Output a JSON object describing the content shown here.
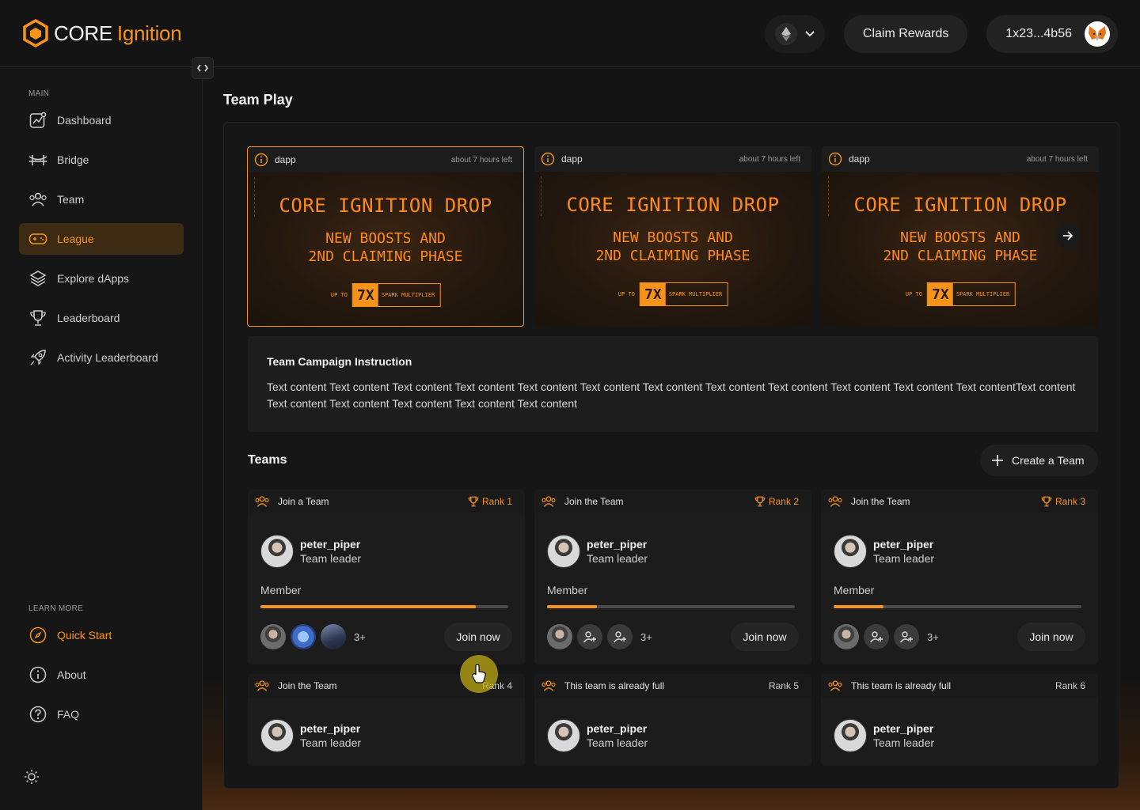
{
  "brand": {
    "core": "CORE",
    "ignition": "Ignition"
  },
  "header": {
    "claim_label": "Claim Rewards",
    "wallet_address": "1x23...4b56",
    "chain_icon": "ethereum-icon"
  },
  "sidebar": {
    "main_label": "MAIN",
    "items": [
      {
        "label": "Dashboard",
        "icon": "chart-icon"
      },
      {
        "label": "Bridge",
        "icon": "bridge-icon"
      },
      {
        "label": "Team",
        "icon": "users-icon"
      },
      {
        "label": "League",
        "icon": "gamepad-icon",
        "active": true
      },
      {
        "label": "Explore dApps",
        "icon": "layers-icon"
      },
      {
        "label": "Leaderboard",
        "icon": "trophy-icon"
      },
      {
        "label": "Activity Leaderboard",
        "icon": "rocket-icon"
      }
    ],
    "learn_label": "LEARN MORE",
    "learn_items": [
      {
        "label": "Quick Start",
        "icon": "compass-icon"
      },
      {
        "label": "About",
        "icon": "info-icon"
      },
      {
        "label": "FAQ",
        "icon": "question-icon"
      }
    ]
  },
  "page": {
    "title": "Team Play"
  },
  "banners": [
    {
      "tag": "dapp",
      "time": "about 7 hours left",
      "headline": "CORE IGNITION DROP",
      "line1": "NEW BOOSTS AND",
      "line2": "2ND CLAIMING PHASE",
      "up_to": "UP TO",
      "multiplier": "7X",
      "mult_label": "SPARK MULTIPLIER",
      "selected": true
    },
    {
      "tag": "dapp",
      "time": "about 7 hours left",
      "headline": "CORE IGNITION DROP",
      "line1": "NEW BOOSTS AND",
      "line2": "2ND CLAIMING PHASE",
      "up_to": "UP TO",
      "multiplier": "7X",
      "mult_label": "SPARK MULTIPLIER"
    },
    {
      "tag": "dapp",
      "time": "about 7 hours left",
      "headline": "CORE IGNITION DROP",
      "line1": "NEW BOOSTS AND",
      "line2": "2ND CLAIMING PHASE",
      "up_to": "UP TO",
      "multiplier": "7X",
      "mult_label": "SPARK MULTIPLIER"
    }
  ],
  "instruction": {
    "title": "Team Campaign Instruction",
    "body": "Text content Text content Text content Text content Text content Text content Text content Text content Text content Text content Text content Text contentText content Text content Text content Text content Text content Text content"
  },
  "teams_section": {
    "title": "Teams",
    "create_label": "Create a Team"
  },
  "teams": [
    {
      "status": "Join a Team",
      "rank": "Rank 1",
      "leader": "peter_piper",
      "role": "Team leader",
      "member_label": "Member",
      "fill": 0.87,
      "more": "3+",
      "join": "Join now"
    },
    {
      "status": "Join the Team",
      "rank": "Rank 2",
      "leader": "peter_piper",
      "role": "Team leader",
      "member_label": "Member",
      "fill": 0.2,
      "more": "3+",
      "join": "Join now"
    },
    {
      "status": "Join the Team",
      "rank": "Rank 3",
      "leader": "peter_piper",
      "role": "Team leader",
      "member_label": "Member",
      "fill": 0.2,
      "more": "3+",
      "join": "Join now"
    },
    {
      "status": "Join the Team",
      "rank": "Rank 4",
      "leader": "peter_piper",
      "role": "Team leader"
    },
    {
      "status": "This team is already full",
      "rank": "Rank 5",
      "leader": "peter_piper",
      "role": "Team leader"
    },
    {
      "status": "This team is already full",
      "rank": "Rank 6",
      "leader": "peter_piper",
      "role": "Team leader"
    }
  ],
  "colors": {
    "accent": "#f7931a",
    "background": "#141414",
    "card": "#1c1c1c"
  }
}
